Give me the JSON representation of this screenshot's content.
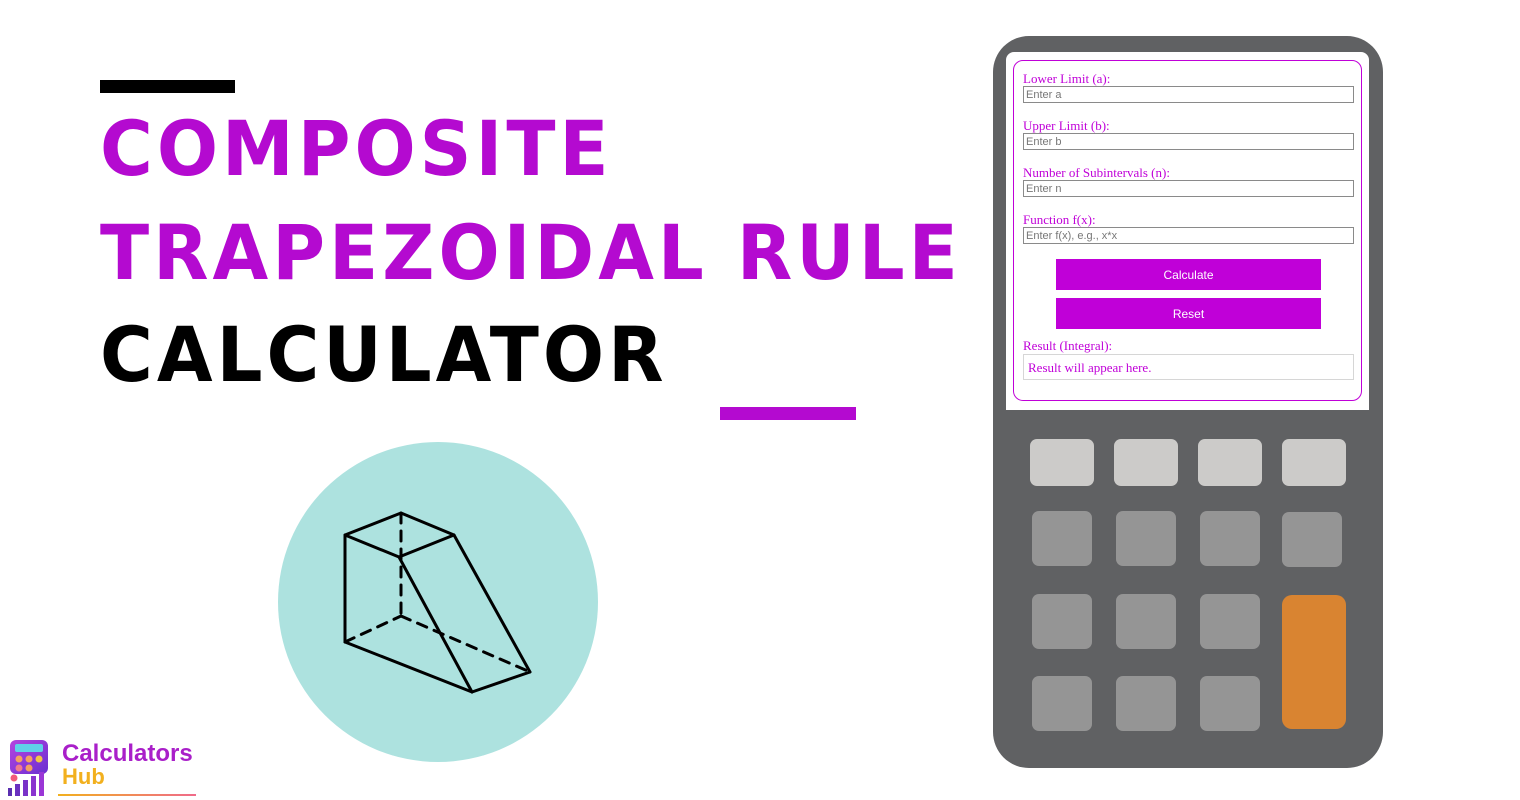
{
  "headline": {
    "line1": "COMPOSITE",
    "line2": "TRAPEZOIDAL RULE",
    "line3": "CALCULATOR"
  },
  "colors": {
    "accent": "#b40ad0",
    "form_accent": "#c000d8",
    "illustration_circle": "#ade2df",
    "calculator_body": "#606163",
    "key_light": "#cccbc9",
    "key_mid": "#959595",
    "key_orange": "#d98431"
  },
  "form": {
    "fields": [
      {
        "label": "Lower Limit (a):",
        "placeholder": "Enter a",
        "value": ""
      },
      {
        "label": "Upper Limit (b):",
        "placeholder": "Enter b",
        "value": ""
      },
      {
        "label": "Number of Subintervals (n):",
        "placeholder": "Enter n",
        "value": ""
      },
      {
        "label": "Function f(x):",
        "placeholder": "Enter f(x), e.g., x*x",
        "value": ""
      }
    ],
    "calculate_label": "Calculate",
    "reset_label": "Reset",
    "result_label": "Result (Integral):",
    "result_text": "Result will appear here."
  },
  "illustration": {
    "icon": "trapezoidal-prism-icon"
  },
  "logo": {
    "word1": "Calculators",
    "word2": "Hub",
    "icon": "calculator-chart-icon"
  }
}
